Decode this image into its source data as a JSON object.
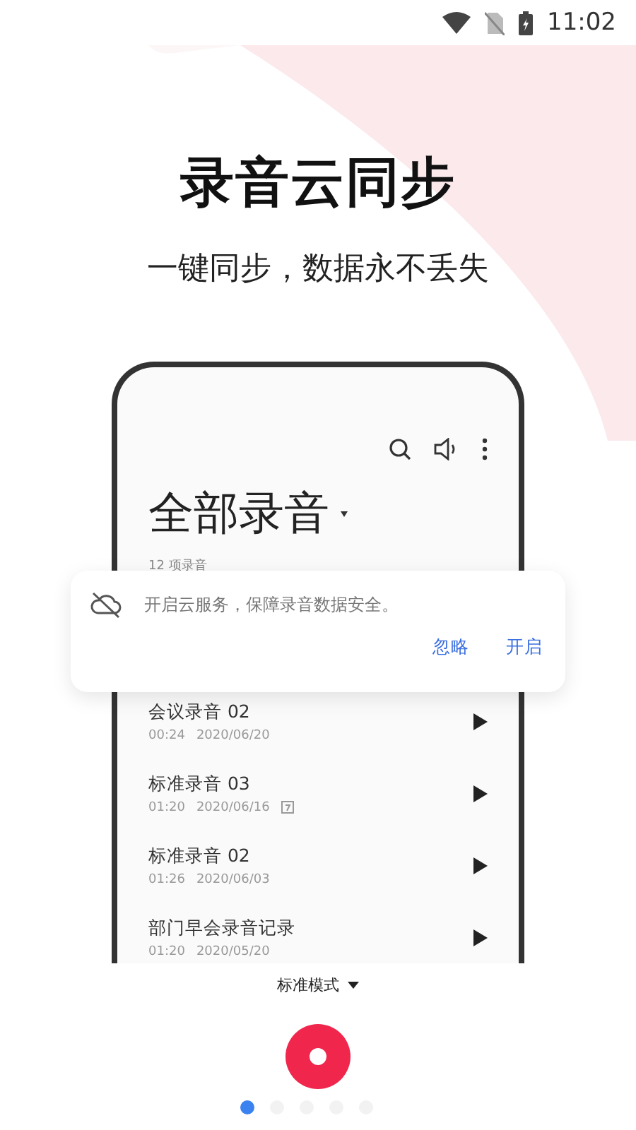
{
  "status_bar": {
    "time": "11:02"
  },
  "hero": {
    "title": "录音云同步",
    "subtitle": "一键同步，数据永不丢失"
  },
  "phone": {
    "heading": "全部录音",
    "count": "12 项录音",
    "recordings": [
      {
        "name": "会议录音 02",
        "duration": "00:24",
        "date": "2020/06/20",
        "has_note": false
      },
      {
        "name": "标准录音 03",
        "duration": "01:20",
        "date": "2020/06/16",
        "has_note": true
      },
      {
        "name": "标准录音 02",
        "duration": "01:26",
        "date": "2020/06/03",
        "has_note": false
      },
      {
        "name": "部门早会录音记录",
        "duration": "01:20",
        "date": "2020/05/20",
        "has_note": false
      }
    ]
  },
  "cloud_prompt": {
    "message": "开启云服务，保障录音数据安全。",
    "buttons": [
      "忽略",
      "开启"
    ]
  },
  "bottom": {
    "mode": "标准模式",
    "pages": [
      {
        "selected": true
      },
      {
        "selected": false
      },
      {
        "selected": false
      },
      {
        "selected": false
      },
      {
        "selected": false
      }
    ]
  }
}
